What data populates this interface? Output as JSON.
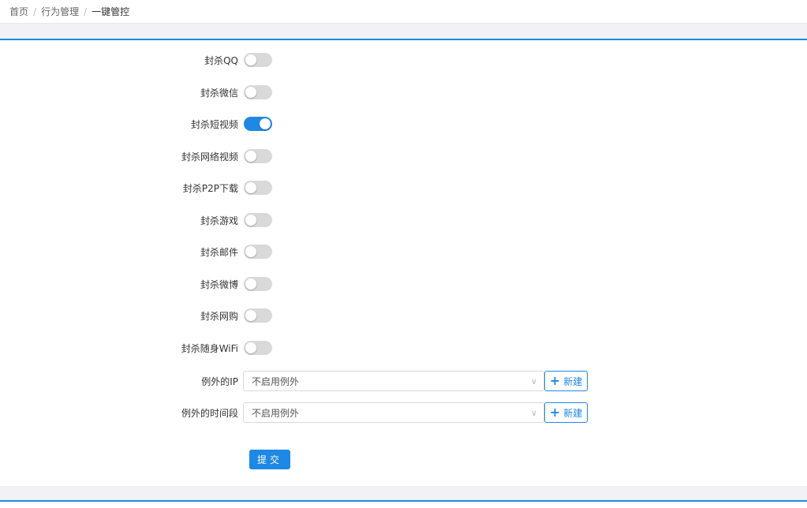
{
  "breadcrumb": {
    "home": "首页",
    "section": "行为管理",
    "current": "一键管控",
    "separator": "/"
  },
  "toggles": [
    {
      "label": "封杀QQ",
      "on": false
    },
    {
      "label": "封杀微信",
      "on": false
    },
    {
      "label": "封杀短视频",
      "on": true
    },
    {
      "label": "封杀网络视频",
      "on": false
    },
    {
      "label": "封杀P2P下载",
      "on": false
    },
    {
      "label": "封杀游戏",
      "on": false
    },
    {
      "label": "封杀邮件",
      "on": false
    },
    {
      "label": "封杀微博",
      "on": false
    },
    {
      "label": "封杀网购",
      "on": false
    },
    {
      "label": "封杀随身WiFi",
      "on": false
    }
  ],
  "exceptions": [
    {
      "label": "例外的IP",
      "value": "不启用例外",
      "button": "新建"
    },
    {
      "label": "例外的时间段",
      "value": "不启用例外",
      "button": "新建"
    }
  ],
  "submit_label": "提交",
  "colors": {
    "accent": "#1e88e5",
    "switch_off": "#d9d9d9"
  }
}
